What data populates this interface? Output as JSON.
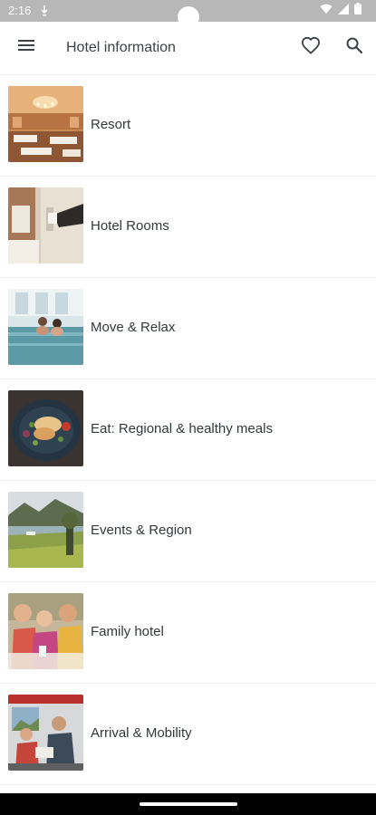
{
  "status_bar": {
    "time": "2:16",
    "icons": [
      "notification-icon",
      "wifi-icon",
      "signal-icon",
      "battery-icon"
    ]
  },
  "app_bar": {
    "title": "Hotel information",
    "icons": [
      "menu-icon",
      "heart-icon",
      "search-icon"
    ]
  },
  "list": {
    "items": [
      {
        "label": "Resort",
        "thumbnail": "restaurant-interior"
      },
      {
        "label": "Hotel Rooms",
        "thumbnail": "hotel-room-keycard"
      },
      {
        "label": "Move & Relax",
        "thumbnail": "indoor-pool"
      },
      {
        "label": "Eat: Regional & healthy meals",
        "thumbnail": "plated-meal"
      },
      {
        "label": "Events & Region",
        "thumbnail": "alpine-lake-landscape"
      },
      {
        "label": "Family hotel",
        "thumbnail": "family-at-table"
      },
      {
        "label": "Arrival & Mobility",
        "thumbnail": "train-passengers"
      }
    ]
  },
  "colors": {
    "status_bar": "#b7b7b7",
    "app_title": "#3c4248",
    "label_text": "#33383d",
    "divider": "#efefef"
  }
}
